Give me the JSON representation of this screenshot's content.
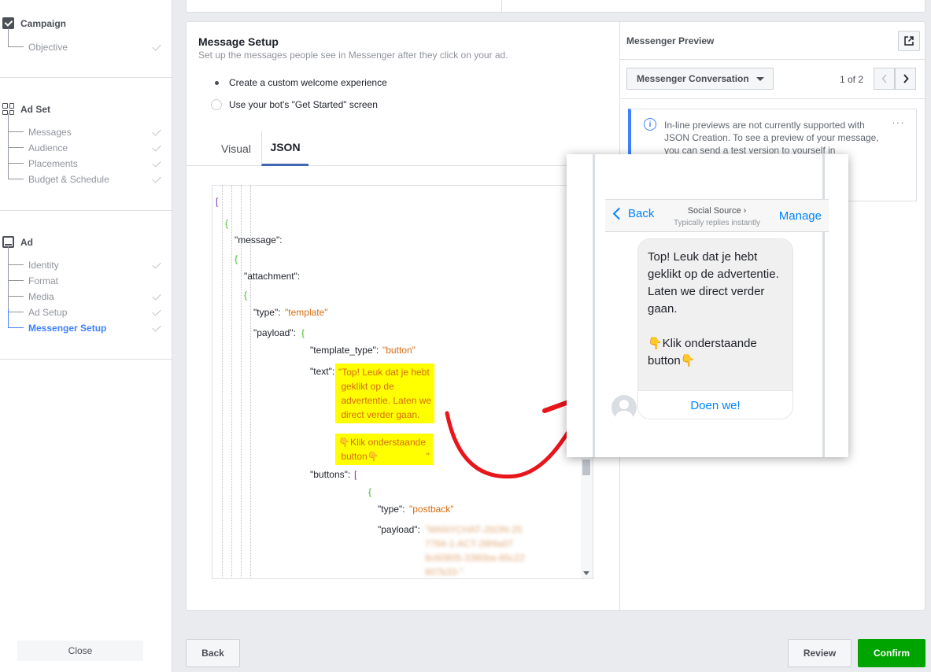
{
  "sidebar": {
    "campaign": {
      "title": "Campaign",
      "items": [
        {
          "label": "Objective"
        }
      ]
    },
    "adset": {
      "title": "Ad Set",
      "items": [
        {
          "label": "Messages"
        },
        {
          "label": "Audience"
        },
        {
          "label": "Placements"
        },
        {
          "label": "Budget & Schedule"
        }
      ]
    },
    "ad": {
      "title": "Ad",
      "items": [
        {
          "label": "Identity"
        },
        {
          "label": "Format"
        },
        {
          "label": "Media"
        },
        {
          "label": "Ad Setup"
        },
        {
          "label": "Messenger Setup"
        }
      ]
    },
    "close_label": "Close"
  },
  "setup": {
    "title": "Message Setup",
    "subtitle": "Set up the messages people see in Messenger after they click on your ad.",
    "options": [
      "Create a custom welcome experience",
      "Use your bot's \"Get Started\" screen"
    ],
    "selected_option": 0,
    "tabs": [
      "Visual",
      "JSON"
    ],
    "active_tab": "JSON"
  },
  "json_editor": {
    "open_bracket": "[",
    "open_brace": "{",
    "key_message": "\"message\":",
    "key_attachment": "\"attachment\":",
    "key_type": "\"type\":",
    "val_template": "\"template\"",
    "key_payload": "\"payload\":",
    "key_template_type": "\"template_type\":",
    "val_button": "\"button\"",
    "key_text": "\"text\":",
    "text_value_1": "\"Top! Leuk dat je hebt\n geklikt op de\n advertentie. Laten we\n direct verder gaan.",
    "text_value_2": "👇Klik onderstaande\n button👇                  \"",
    "key_buttons": "\"buttons\":",
    "val_postback": "\"postback\"",
    "payload_value": "\"MANYCHAT-JSON-25\n7784-1-ACT-28f4a07\n8c60805-3380ba-85c22\n807b33-\""
  },
  "preview": {
    "title": "Messenger Preview",
    "dropdown_label": "Messenger Conversation",
    "page_count": "1 of 2",
    "info_text": "In-line previews are not currently supported with JSON Creation. To see a preview of your message, you can send a test version to yourself in",
    "phone": {
      "back_label": "Back",
      "page_name": "Social Source",
      "page_status": "Typically replies instantly",
      "manage_label": "Manage",
      "message_text": "Top! Leuk dat je hebt geklikt op de advertentie. Laten we direct verder gaan.\n\n👇Klik onderstaande button👇",
      "button_label": "Doen we!"
    }
  },
  "footer": {
    "back_label": "Back",
    "review_label": "Review",
    "confirm_label": "Confirm"
  },
  "colors": {
    "accent_blue": "#4080ff",
    "confirm_green": "#00a400",
    "highlight_yellow": "#ffff00",
    "annotation_red": "#e8151b",
    "messenger_blue": "#0084ff"
  }
}
